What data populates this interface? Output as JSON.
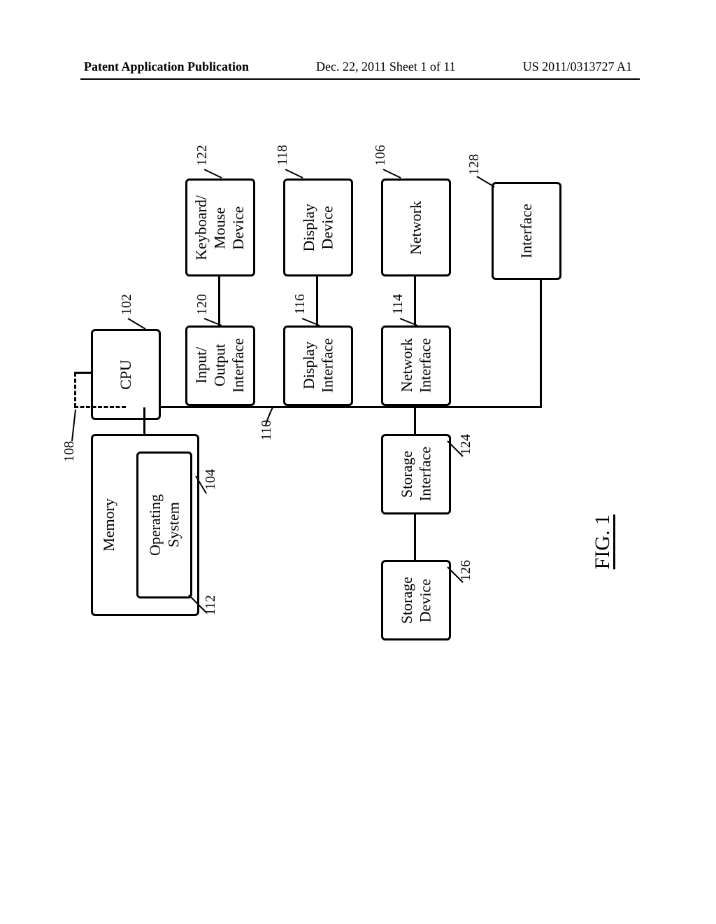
{
  "header": {
    "left": "Patent Application Publication",
    "center": "Dec. 22, 2011  Sheet 1 of 11",
    "right": "US 2011/0313727 A1"
  },
  "figure_label": "FIG. 1",
  "boxes": {
    "cpu": {
      "label": "CPU",
      "ref": "102"
    },
    "memory": {
      "label": "Memory",
      "ref": "104"
    },
    "operating_system": {
      "label": "Operating\nSystem",
      "ref": "112"
    },
    "keyboard_mouse": {
      "label": "Keyboard/\nMouse\nDevice",
      "ref": "122"
    },
    "io_interface": {
      "label": "Input/\nOutput\nInterface",
      "ref": "120"
    },
    "display_device": {
      "label": "Display\nDevice",
      "ref": "118"
    },
    "display_interface": {
      "label": "Display\nInterface",
      "ref": "116"
    },
    "network": {
      "label": "Network",
      "ref": "106"
    },
    "network_interface": {
      "label": "Network\nInterface",
      "ref": "114"
    },
    "interface": {
      "label": "Interface",
      "ref": "128"
    },
    "storage_interface": {
      "label": "Storage\nInterface",
      "ref": "124"
    },
    "storage_device": {
      "label": "Storage\nDevice",
      "ref": "126"
    }
  },
  "refs": {
    "dashed": "108",
    "bus": "110"
  }
}
